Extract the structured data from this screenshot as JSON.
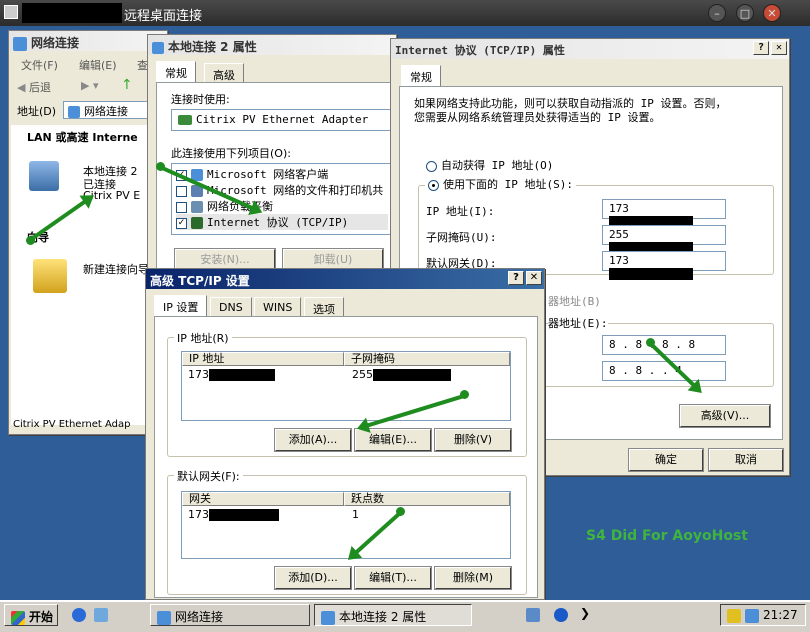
{
  "rdp": {
    "title": "远程桌面连接"
  },
  "netconn": {
    "title": "网络连接",
    "menu": [
      "文件(F)",
      "编辑(E)",
      "查"
    ],
    "back": "后退",
    "address_label": "地址(D)",
    "address_value": "网络连接",
    "section_lan": "LAN 或高速 Interne",
    "item_name": "本地连接 2",
    "item_status": "已连接",
    "item_adapter": "Citrix PV E",
    "section_wizard": "向导",
    "wizard_item": "新建连接向导",
    "statusbar": "Citrix PV Ethernet Adap"
  },
  "props": {
    "title": "本地连接 2 属性",
    "tabs": [
      "常规",
      "高级"
    ],
    "connect_using": "连接时使用:",
    "adapter": "Citrix PV Ethernet Adapter",
    "items_label": "此连接使用下列项目(O):",
    "items": [
      {
        "label": "Microsoft 网络客户端",
        "checked": "✓"
      },
      {
        "label": "Microsoft 网络的文件和打印机共",
        "checked": ""
      },
      {
        "label": "网络负载平衡",
        "checked": ""
      },
      {
        "label": "Internet 协议 (TCP/IP)",
        "checked": "✓"
      }
    ],
    "install": "安装(N)...",
    "uninstall": "卸载(U)"
  },
  "tcpip": {
    "title": "Internet 协议 (TCP/IP) 属性",
    "tab": "常规",
    "desc1": "如果网络支持此功能，则可以获取自动指派的 IP 设置。否则，",
    "desc2": "您需要从网络系统管理员处获得适当的 IP 设置。",
    "auto_ip": "自动获得 IP 地址(O)",
    "manual_ip": "使用下面的 IP 地址(S):",
    "ip_label": "IP 地址(I):",
    "ip_value": "173",
    "mask_label": "子网掩码(U):",
    "mask_value": "255",
    "gw_label": "默认网关(D):",
    "gw_value": "173",
    "dns_auto_frag": "器地址(B)",
    "dns_manual_frag": "器地址(E):",
    "dns1": "8 . 8 . 8 . 8",
    "dns2": "8 . 8 .   . 4",
    "advanced": "高级(V)...",
    "ok": "确定",
    "cancel": "取消"
  },
  "adv": {
    "title": "高级 TCP/IP 设置",
    "tabs": [
      "IP 设置",
      "DNS",
      "WINS",
      "选项"
    ],
    "ip_group": "IP 地址(R)",
    "col_ip": "IP 地址",
    "col_mask": "子网掩码",
    "row_ip": "173",
    "row_mask": "255",
    "gw_group": "默认网关(F):",
    "col_gw": "网关",
    "col_metric": "跃点数",
    "row_gw": "173",
    "row_metric": "1",
    "add": "添加(A)...",
    "edit": "编辑(E)...",
    "remove": "删除(V)",
    "add2": "添加(D)...",
    "edit2": "编辑(T)...",
    "remove2": "删除(M)"
  },
  "watermark": "S4 Did For AoyoHost",
  "taskbar": {
    "start": "开始",
    "task1": "网络连接",
    "task2": "本地连接 2 属性",
    "clock": "21:27"
  },
  "colors": {
    "arrow": "#1f8c1f",
    "titlebar_active": "#0a246a",
    "watermark": "#3fb43f"
  }
}
